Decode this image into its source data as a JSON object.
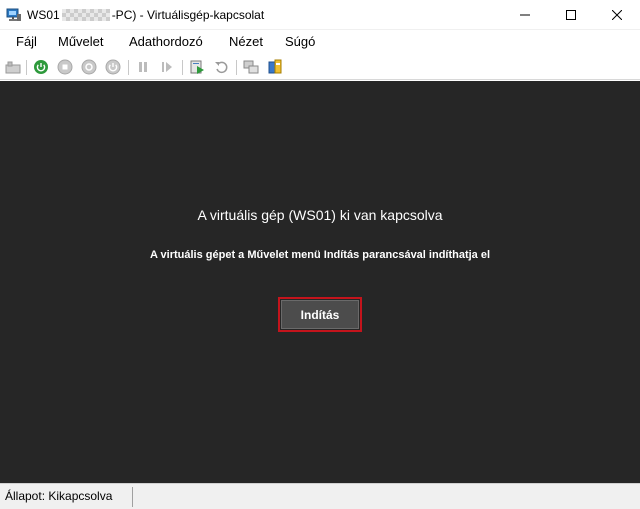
{
  "window": {
    "title_prefix": "WS01",
    "title_suffix": "-PC) - Virtuálisgép-kapcsolat",
    "icon": "hyper-v-connection-icon",
    "controls": [
      "minimize-icon",
      "maximize-icon",
      "close-icon"
    ]
  },
  "menu": {
    "items": [
      {
        "label": "Fájl"
      },
      {
        "label": "Művelet"
      },
      {
        "label": "Adathordozó"
      },
      {
        "label": "Nézet"
      },
      {
        "label": "Súgó"
      }
    ]
  },
  "toolbar": {
    "icons": [
      "ctrl-alt-del-icon",
      "start-icon",
      "turn-off-icon",
      "shut-down-icon",
      "power-icon",
      "pause-icon",
      "resume-icon",
      "checkpoint-icon",
      "revert-icon",
      "enhanced-session-icon",
      "share-icon"
    ]
  },
  "screen": {
    "title": "A virtuális gép (WS01) ki van kapcsolva",
    "subtitle": "A virtuális gépet a Művelet menü Indítás parancsával indíthatja el",
    "start_button": "Indítás",
    "background": "#262626",
    "highlight_color": "#c4141c"
  },
  "status": {
    "text": "Állapot: Kikapcsolva"
  }
}
